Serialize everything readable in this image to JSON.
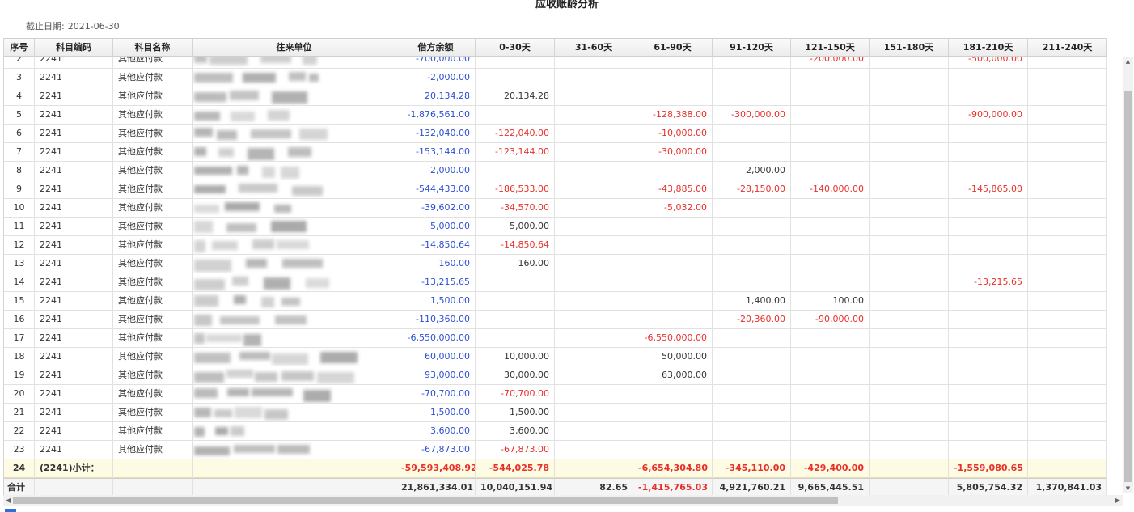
{
  "title": "应收账龄分析",
  "as_of_label": "截止日期:",
  "as_of_value": "2021-06-30",
  "columns": [
    "序号",
    "科目编码",
    "科目名称",
    "往来单位",
    "借方余额",
    "0-30天",
    "31-60天",
    "61-90天",
    "91-120天",
    "121-150天",
    "151-180天",
    "181-210天",
    "211-240天"
  ],
  "rows": [
    {
      "seq": "2",
      "code": "2241",
      "name": "其他应付款",
      "debit": "-700,000.00",
      "b0_30": "",
      "b31_60": "",
      "b61_90": "",
      "b91_120": "",
      "b121_150": "-200,000.00",
      "b151_180": "",
      "b181_210": "-500,000.00",
      "b211_240": ""
    },
    {
      "seq": "3",
      "code": "2241",
      "name": "其他应付款",
      "debit": "-2,000.00",
      "b0_30": "",
      "b31_60": "",
      "b61_90": "",
      "b91_120": "",
      "b121_150": "",
      "b151_180": "",
      "b181_210": "",
      "b211_240": ""
    },
    {
      "seq": "4",
      "code": "2241",
      "name": "其他应付款",
      "debit": "20,134.28",
      "b0_30": "20,134.28",
      "b31_60": "",
      "b61_90": "",
      "b91_120": "",
      "b121_150": "",
      "b151_180": "",
      "b181_210": "",
      "b211_240": ""
    },
    {
      "seq": "5",
      "code": "2241",
      "name": "其他应付款",
      "debit": "-1,876,561.00",
      "b0_30": "",
      "b31_60": "",
      "b61_90": "-128,388.00",
      "b91_120": "-300,000.00",
      "b121_150": "",
      "b151_180": "",
      "b181_210": "-900,000.00",
      "b211_240": ""
    },
    {
      "seq": "6",
      "code": "2241",
      "name": "其他应付款",
      "debit": "-132,040.00",
      "b0_30": "-122,040.00",
      "b31_60": "",
      "b61_90": "-10,000.00",
      "b91_120": "",
      "b121_150": "",
      "b151_180": "",
      "b181_210": "",
      "b211_240": ""
    },
    {
      "seq": "7",
      "code": "2241",
      "name": "其他应付款",
      "debit": "-153,144.00",
      "b0_30": "-123,144.00",
      "b31_60": "",
      "b61_90": "-30,000.00",
      "b91_120": "",
      "b121_150": "",
      "b151_180": "",
      "b181_210": "",
      "b211_240": ""
    },
    {
      "seq": "8",
      "code": "2241",
      "name": "其他应付款",
      "debit": "2,000.00",
      "b0_30": "",
      "b31_60": "",
      "b61_90": "",
      "b91_120": "2,000.00",
      "b121_150": "",
      "b151_180": "",
      "b181_210": "",
      "b211_240": ""
    },
    {
      "seq": "9",
      "code": "2241",
      "name": "其他应付款",
      "debit": "-544,433.00",
      "b0_30": "-186,533.00",
      "b31_60": "",
      "b61_90": "-43,885.00",
      "b91_120": "-28,150.00",
      "b121_150": "-140,000.00",
      "b151_180": "",
      "b181_210": "-145,865.00",
      "b211_240": ""
    },
    {
      "seq": "10",
      "code": "2241",
      "name": "其他应付款",
      "debit": "-39,602.00",
      "b0_30": "-34,570.00",
      "b31_60": "",
      "b61_90": "-5,032.00",
      "b91_120": "",
      "b121_150": "",
      "b151_180": "",
      "b181_210": "",
      "b211_240": ""
    },
    {
      "seq": "11",
      "code": "2241",
      "name": "其他应付款",
      "debit": "5,000.00",
      "b0_30": "5,000.00",
      "b31_60": "",
      "b61_90": "",
      "b91_120": "",
      "b121_150": "",
      "b151_180": "",
      "b181_210": "",
      "b211_240": ""
    },
    {
      "seq": "12",
      "code": "2241",
      "name": "其他应付款",
      "debit": "-14,850.64",
      "b0_30": "-14,850.64",
      "b31_60": "",
      "b61_90": "",
      "b91_120": "",
      "b121_150": "",
      "b151_180": "",
      "b181_210": "",
      "b211_240": ""
    },
    {
      "seq": "13",
      "code": "2241",
      "name": "其他应付款",
      "debit": "160.00",
      "b0_30": "160.00",
      "b31_60": "",
      "b61_90": "",
      "b91_120": "",
      "b121_150": "",
      "b151_180": "",
      "b181_210": "",
      "b211_240": ""
    },
    {
      "seq": "14",
      "code": "2241",
      "name": "其他应付款",
      "debit": "-13,215.65",
      "b0_30": "",
      "b31_60": "",
      "b61_90": "",
      "b91_120": "",
      "b121_150": "",
      "b151_180": "",
      "b181_210": "-13,215.65",
      "b211_240": ""
    },
    {
      "seq": "15",
      "code": "2241",
      "name": "其他应付款",
      "debit": "1,500.00",
      "b0_30": "",
      "b31_60": "",
      "b61_90": "",
      "b91_120": "1,400.00",
      "b121_150": "100.00",
      "b151_180": "",
      "b181_210": "",
      "b211_240": ""
    },
    {
      "seq": "16",
      "code": "2241",
      "name": "其他应付款",
      "debit": "-110,360.00",
      "b0_30": "",
      "b31_60": "",
      "b61_90": "",
      "b91_120": "-20,360.00",
      "b121_150": "-90,000.00",
      "b151_180": "",
      "b181_210": "",
      "b211_240": ""
    },
    {
      "seq": "17",
      "code": "2241",
      "name": "其他应付款",
      "debit": "-6,550,000.00",
      "b0_30": "",
      "b31_60": "",
      "b61_90": "-6,550,000.00",
      "b91_120": "",
      "b121_150": "",
      "b151_180": "",
      "b181_210": "",
      "b211_240": ""
    },
    {
      "seq": "18",
      "code": "2241",
      "name": "其他应付款",
      "debit": "60,000.00",
      "b0_30": "10,000.00",
      "b31_60": "",
      "b61_90": "50,000.00",
      "b91_120": "",
      "b121_150": "",
      "b151_180": "",
      "b181_210": "",
      "b211_240": ""
    },
    {
      "seq": "19",
      "code": "2241",
      "name": "其他应付款",
      "debit": "93,000.00",
      "b0_30": "30,000.00",
      "b31_60": "",
      "b61_90": "63,000.00",
      "b91_120": "",
      "b121_150": "",
      "b151_180": "",
      "b181_210": "",
      "b211_240": ""
    },
    {
      "seq": "20",
      "code": "2241",
      "name": "其他应付款",
      "debit": "-70,700.00",
      "b0_30": "-70,700.00",
      "b31_60": "",
      "b61_90": "",
      "b91_120": "",
      "b121_150": "",
      "b151_180": "",
      "b181_210": "",
      "b211_240": ""
    },
    {
      "seq": "21",
      "code": "2241",
      "name": "其他应付款",
      "debit": "1,500.00",
      "b0_30": "1,500.00",
      "b31_60": "",
      "b61_90": "",
      "b91_120": "",
      "b121_150": "",
      "b151_180": "",
      "b181_210": "",
      "b211_240": ""
    },
    {
      "seq": "22",
      "code": "2241",
      "name": "其他应付款",
      "debit": "3,600.00",
      "b0_30": "3,600.00",
      "b31_60": "",
      "b61_90": "",
      "b91_120": "",
      "b121_150": "",
      "b151_180": "",
      "b181_210": "",
      "b211_240": ""
    },
    {
      "seq": "23",
      "code": "2241",
      "name": "其他应付款",
      "debit": "-67,873.00",
      "b0_30": "-67,873.00",
      "b31_60": "",
      "b61_90": "",
      "b91_120": "",
      "b121_150": "",
      "b151_180": "",
      "b181_210": "",
      "b211_240": ""
    }
  ],
  "subtotal": {
    "seq": "24",
    "label": "(2241)小计：",
    "debit": "-59,593,408.92",
    "b0_30": "-544,025.78",
    "b31_60": "",
    "b61_90": "-6,654,304.80",
    "b91_120": "-345,110.00",
    "b121_150": "-429,400.00",
    "b151_180": "",
    "b181_210": "-1,559,080.65",
    "b211_240": ""
  },
  "total": {
    "label": "合计",
    "debit": "21,861,334.01",
    "b0_30": "10,040,151.94",
    "b31_60": "82.65",
    "b61_90": "-1,415,765.03",
    "b91_120": "4,921,760.21",
    "b121_150": "9,665,445.51",
    "b151_180": "",
    "b181_210": "5,805,754.32",
    "b211_240": "1,370,841.03"
  },
  "colors": {
    "negative": "#e8302a",
    "positive_debit": "#2b4fd6",
    "subtotal_bg": "#fdfbe3",
    "total_bg": "#f5f5f5"
  },
  "icons": {
    "scroll_up": "triangle-up-icon",
    "scroll_down": "triangle-down-icon",
    "scroll_left": "triangle-left-icon",
    "scroll_right": "triangle-right-icon"
  }
}
